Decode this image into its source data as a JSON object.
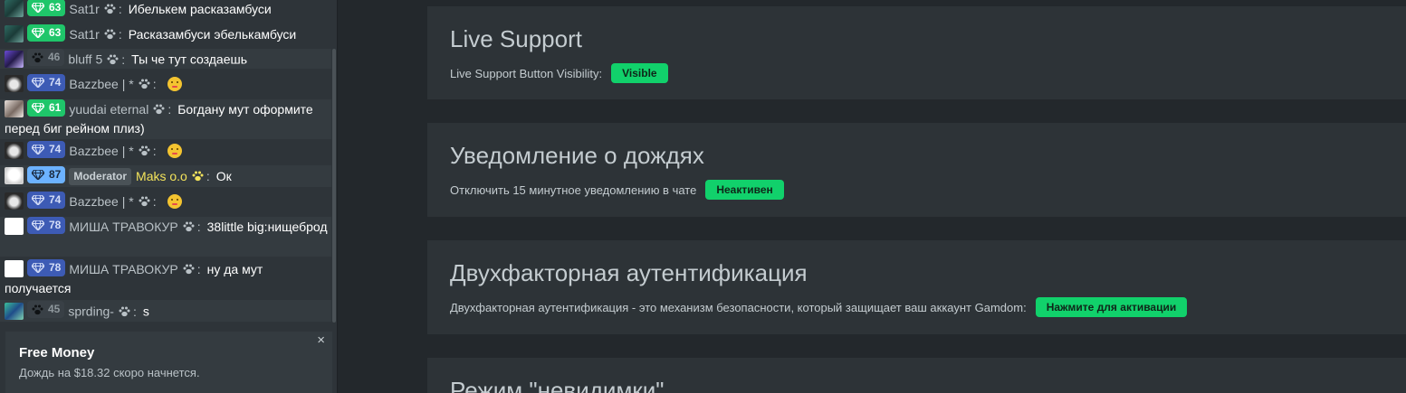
{
  "chat": {
    "messages": [
      {
        "level": "63",
        "user": "Sat1r",
        "text": "Ибелькем расказамбуси"
      },
      {
        "level": "63",
        "user": "Sat1r",
        "text": "Расказамбуси эбелькамбуси"
      },
      {
        "level": "46",
        "user": "bluff 5",
        "text": "Ты че тут создаешь"
      },
      {
        "level": "74",
        "user": "Bazzbee | *",
        "text": ""
      },
      {
        "level": "61",
        "user": "yuudai eternal",
        "text": "Богдану мут оформите перед биг рейном плиз)"
      },
      {
        "level": "74",
        "user": "Bazzbee | *",
        "text": ""
      },
      {
        "level": "87",
        "role": "Moderator",
        "user": "Maks o.o",
        "text": "Ок"
      },
      {
        "level": "74",
        "user": "Bazzbee | *",
        "text": ""
      },
      {
        "level": "78",
        "user": "МИША ТРАВОКУР",
        "text": "38little big:нищеброд"
      },
      {
        "level": "78",
        "user": "МИША ТРАВОКУР",
        "text": "ну да мут получается"
      },
      {
        "level": "45",
        "user": "sprding-",
        "text": "s"
      }
    ],
    "separator": ":"
  },
  "notification": {
    "title": "Free Money",
    "text": "Дождь на $18.32 скоро начнется.",
    "close": "×"
  },
  "settings": {
    "live_support": {
      "title": "Live Support",
      "label": "Live Support Button Visibility:",
      "button": "Visible"
    },
    "rain": {
      "title": "Уведомление о дождях",
      "label": "Отключить 15 минутное уведомлению в чате",
      "button": "Неактивен"
    },
    "two_factor": {
      "title": "Двухфакторная аутентификация",
      "label": "Двухфакторная аутентификация - это механизм безопасности, который защищает ваш аккаунт Gamdom:",
      "button": "Нажмите для активации"
    },
    "invisible": {
      "title": "Режим \"невидимки\""
    }
  },
  "colors": {
    "accent": "#11d16b",
    "badge_green": "#1fc66a",
    "badge_blue": "#3d5bb5",
    "moderator_name": "#f3e35b"
  }
}
